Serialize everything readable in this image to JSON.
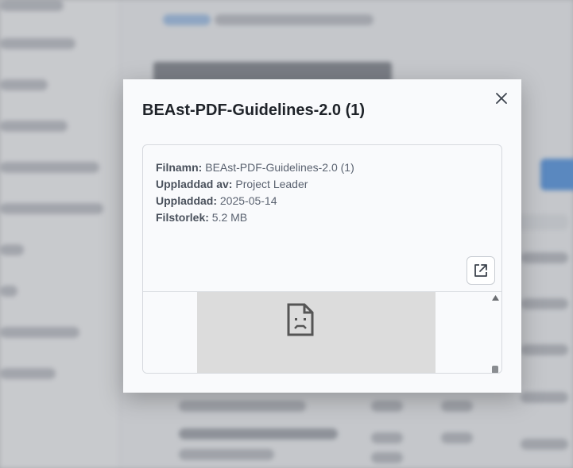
{
  "modal": {
    "title": "BEAst-PDF-Guidelines-2.0 (1)",
    "close_icon": "close-icon",
    "open_external_icon": "external-link-icon",
    "preview_icon": "broken-document-icon",
    "metadata": [
      {
        "label": "Filnamn:",
        "value": "BEAst-PDF-Guidelines-2.0 (1)"
      },
      {
        "label": "Uppladdad av:",
        "value": "Project Leader"
      },
      {
        "label": "Uppladdad:",
        "value": "2025-05-14"
      },
      {
        "label": "Filstorlek:",
        "value": "5.2 MB"
      }
    ]
  },
  "colors": {
    "accent": "#4b8fe0",
    "modal_bg": "#f9fafc",
    "text_primary": "#1f2329",
    "text_secondary": "#5a6270"
  }
}
